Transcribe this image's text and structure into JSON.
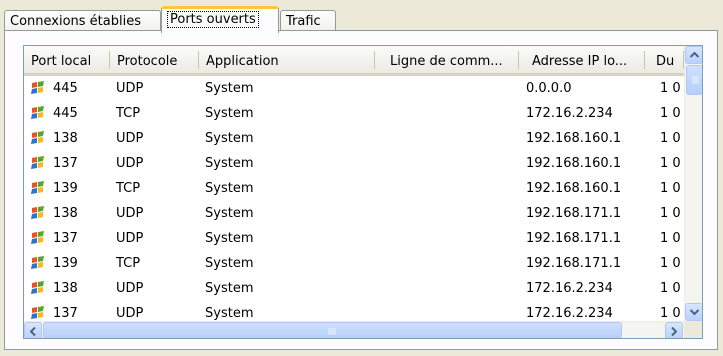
{
  "tabs": [
    {
      "label": "Connexions établies"
    },
    {
      "label": "Ports ouverts"
    },
    {
      "label": "Trafic"
    }
  ],
  "table": {
    "columns": [
      "Port local",
      "Protocole",
      "Application",
      "Ligne de comm...",
      "Adresse IP lo...",
      "Du"
    ],
    "rows": [
      {
        "port": "445",
        "protocol": "UDP",
        "app": "System",
        "cmd": "",
        "ip": "0.0.0.0",
        "du": "1 0"
      },
      {
        "port": "445",
        "protocol": "TCP",
        "app": "System",
        "cmd": "",
        "ip": "172.16.2.234",
        "du": "1 0"
      },
      {
        "port": "138",
        "protocol": "UDP",
        "app": "System",
        "cmd": "",
        "ip": "192.168.160.1",
        "du": "1 0"
      },
      {
        "port": "137",
        "protocol": "UDP",
        "app": "System",
        "cmd": "",
        "ip": "192.168.160.1",
        "du": "1 0"
      },
      {
        "port": "139",
        "protocol": "TCP",
        "app": "System",
        "cmd": "",
        "ip": "192.168.160.1",
        "du": "1 0"
      },
      {
        "port": "138",
        "protocol": "UDP",
        "app": "System",
        "cmd": "",
        "ip": "192.168.171.1",
        "du": "1 0"
      },
      {
        "port": "137",
        "protocol": "UDP",
        "app": "System",
        "cmd": "",
        "ip": "192.168.171.1",
        "du": "1 0"
      },
      {
        "port": "139",
        "protocol": "TCP",
        "app": "System",
        "cmd": "",
        "ip": "192.168.171.1",
        "du": "1 0"
      },
      {
        "port": "138",
        "protocol": "UDP",
        "app": "System",
        "cmd": "",
        "ip": "172.16.2.234",
        "du": "1 0"
      },
      {
        "port": "137",
        "protocol": "UDP",
        "app": "System",
        "cmd": "",
        "ip": "172.16.2.234",
        "du": "1 0"
      }
    ]
  },
  "icons": {
    "row_icon": "windows-flag-icon"
  },
  "colors": {
    "active_tab_accent": "#ffc73c",
    "list_border": "#7f9db9",
    "scroll_button": "#c3d6fc"
  }
}
